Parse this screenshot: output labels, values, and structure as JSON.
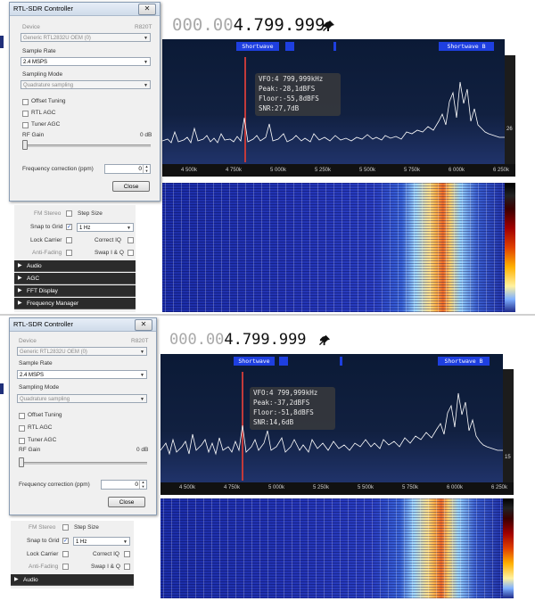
{
  "controller": {
    "title": "RTL-SDR Controller",
    "close_glyph": "✕",
    "device_label": "Device",
    "tuner": "R820T",
    "device": "Generic RTL2832U OEM (0)",
    "sample_rate_label": "Sample Rate",
    "sample_rate": "2.4 MSPS",
    "sampling_mode_label": "Sampling Mode",
    "sampling_mode": "Quadrature sampling",
    "offset_tuning_label": "Offset Tuning",
    "rtl_agc_label": "RTL AGC",
    "tuner_agc_label": "Tuner AGC",
    "rf_gain_label": "RF Gain",
    "rf_gain_value": "0 dB",
    "freq_corr_label": "Frequency correction (ppm)",
    "freq_corr_value": "0",
    "close_button": "Close"
  },
  "radio_panel": {
    "fm_stereo": "FM Stereo",
    "step_size": "Step Size",
    "snap_to_grid": "Snap to Grid",
    "snap_check": "✓",
    "step_value": "1 Hz",
    "lock_carrier": "Lock Carrier",
    "correct_iq": "Correct IQ",
    "anti_fading": "Anti-Fading",
    "swap_iq": "Swap I & Q"
  },
  "sections": [
    "Audio",
    "AGC",
    "FFT Display",
    "Frequency Manager"
  ],
  "top": {
    "freq_dim": "000.00",
    "freq_main": "4.799.999",
    "bands": [
      "Shortwave",
      "Shortwave B"
    ],
    "readout": {
      "vfo": "VFO:4 799,999kHz",
      "peak": "Peak:-28,1dBFS",
      "floor": "Floor:-55,8dBFS",
      "snr": "SNR:27,7dB"
    },
    "level": "26",
    "ticks": [
      "4 500k",
      "4 750k",
      "5 000k",
      "5 250k",
      "5 500k",
      "5 750k",
      "6 000k",
      "6 250k"
    ]
  },
  "bottom": {
    "freq_dim": "000.00",
    "freq_main": "4.799.999",
    "bands": [
      "Shortwave",
      "Shortwave B"
    ],
    "readout": {
      "vfo": "VFO:4 799,999kHz",
      "peak": "Peak:-37,2dBFS",
      "floor": "Floor:-51,8dBFS",
      "snr": "SNR:14,6dB"
    },
    "level": "15",
    "ticks": [
      "4 500k",
      "4 750k",
      "5 000k",
      "5 250k",
      "5 500k",
      "5 750k",
      "6 000k",
      "6 250k"
    ]
  },
  "colors": {
    "vfo_line": "#c23a3a",
    "band_tag": "#1e3fe0",
    "spectrum_trace": "#ffffff"
  },
  "icons": {
    "pin": "pin-icon",
    "triangle": "expand-triangle-icon"
  }
}
